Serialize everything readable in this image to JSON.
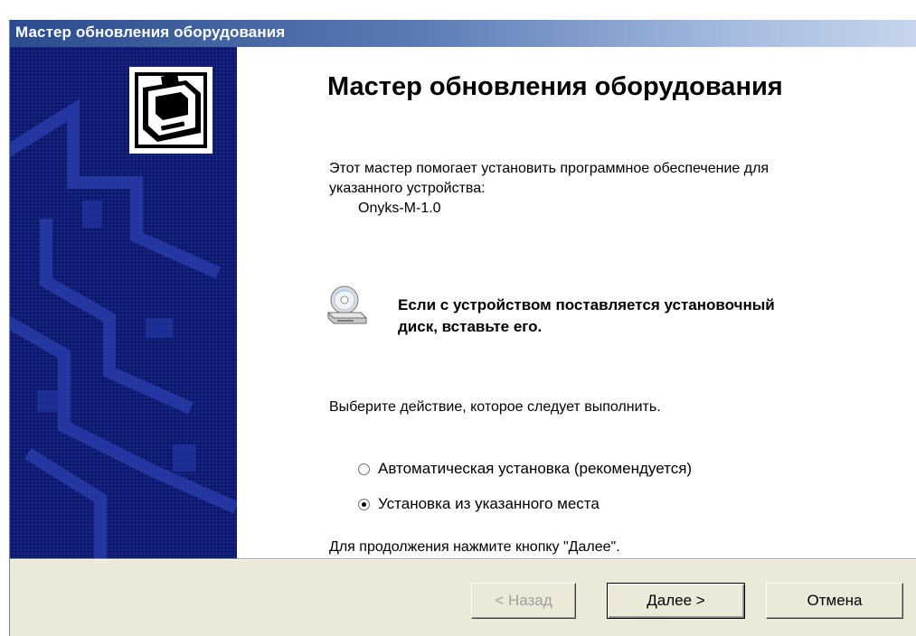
{
  "window": {
    "title": "Мастер обновления оборудования"
  },
  "main": {
    "heading": "Мастер обновления оборудования",
    "intro": "Этот мастер помогает установить программное обеспечение для указанного устройства:",
    "device_name": "Onyks-M-1.0",
    "cd_note": "Если с устройством поставляется установочный диск, вставьте его.",
    "choose_action": "Выберите действие, которое следует выполнить.",
    "options": [
      {
        "label": "Автоматическая установка (рекомендуется)",
        "selected": false
      },
      {
        "label": "Установка из указанного места",
        "selected": true
      }
    ],
    "continue_hint": "Для продолжения нажмите кнопку \"Далее\"."
  },
  "buttons": {
    "back": "< Назад",
    "next": "Далее >",
    "cancel": "Отмена"
  },
  "icons": {
    "sidebar": "hardware-wizard-icon",
    "cd": "cd-drive-icon"
  },
  "colors": {
    "title_bar_start": "#2a4b8d",
    "sidebar": "#0a1670",
    "dialog_face": "#ece9d8"
  }
}
